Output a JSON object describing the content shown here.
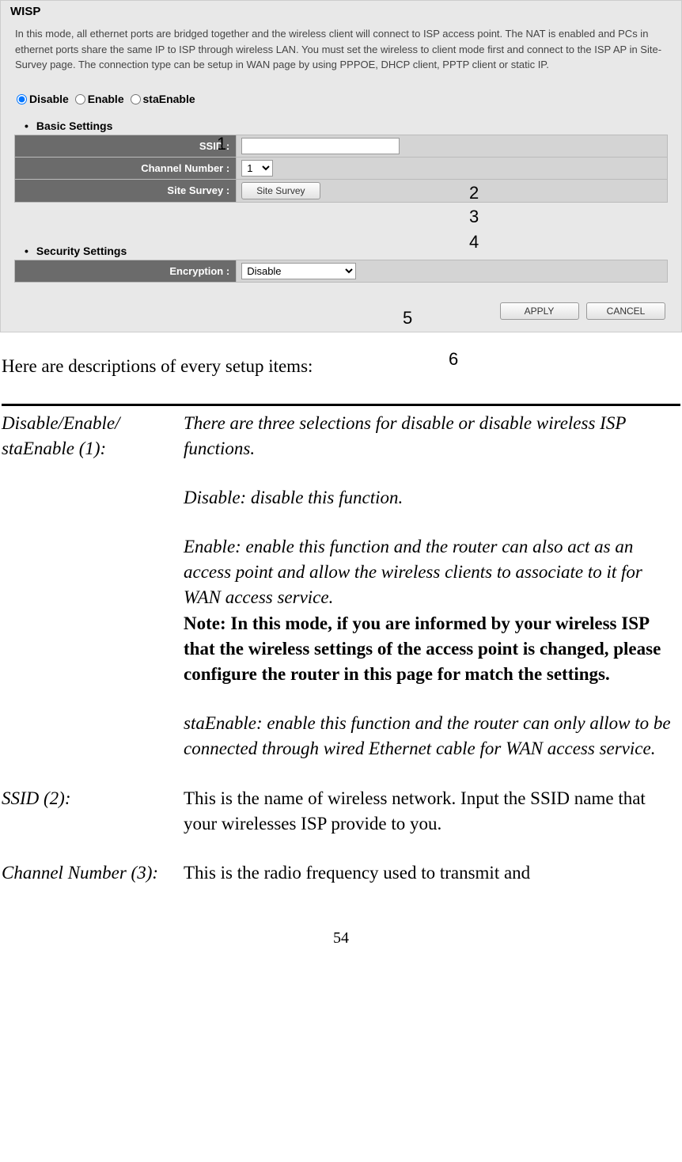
{
  "router": {
    "title": "WISP",
    "description": "In this mode, all ethernet ports are bridged together and the wireless client will connect to ISP access point. The NAT is enabled and PCs in ethernet ports share the same IP to ISP through wireless LAN. You must set the wireless to client mode first and connect to the ISP AP in Site-Survey page. The connection type can be setup in WAN page by using PPPOE, DHCP client, PPTP client or static IP.",
    "radios": {
      "disable": "Disable",
      "enable": "Enable",
      "staEnable": "staEnable"
    },
    "sections": {
      "basic": "Basic Settings",
      "security": "Security Settings"
    },
    "labels": {
      "ssid": "SSID :",
      "channel": "Channel Number :",
      "survey": "Site Survey :",
      "encryption": "Encryption :"
    },
    "values": {
      "ssid": "",
      "channel": "1",
      "encryption": "Disable"
    },
    "buttons": {
      "survey": "Site Survey",
      "apply": "APPLY",
      "cancel": "CANCEL"
    }
  },
  "overlay": {
    "n1": "1",
    "n2": "2",
    "n3": "3",
    "n4": "4",
    "n5": "5",
    "n6": "6"
  },
  "doc": {
    "intro": "Here are descriptions of every setup items:",
    "items": {
      "disable_label": "Disable/Enable/ staEnable (1):",
      "disable_p1": "There are three selections for disable or disable wireless ISP functions.",
      "disable_p2": "Disable: disable this function.",
      "disable_p3a": "Enable: enable this function and the router can also act as an access point and allow the wireless clients to associate to it for WAN access service.",
      "disable_p3b": "Note: In this mode, if you are informed by your wireless ISP that the wireless settings of the access point is changed, please configure the router in this page for match the settings.",
      "disable_p4": "staEnable: enable this function and the router can only allow to be connected through wired Ethernet cable for WAN access service.",
      "ssid_label": "SSID (2):",
      "ssid_desc": "This is the name of wireless network. Input the SSID name that your wirelesses ISP provide to you.",
      "channel_label": "Channel Number (3):",
      "channel_desc": "This is the radio frequency used to transmit and"
    },
    "pagenum": "54"
  }
}
